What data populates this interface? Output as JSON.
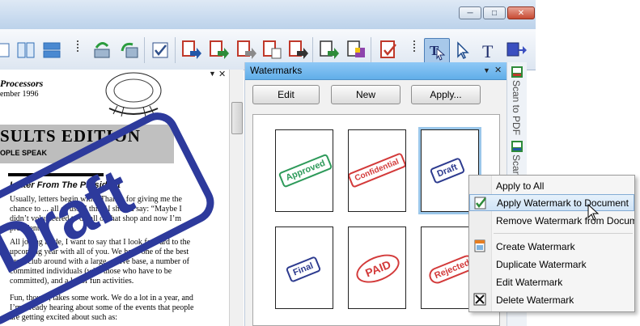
{
  "window": {
    "minimize_icon": "minimize-icon",
    "maximize_icon": "maximize-icon",
    "close_icon": "close-icon"
  },
  "toolbar": {
    "icons": [
      "page-layout-icon",
      "two-columns-icon",
      "split-view-icon",
      "scan-icon",
      "refresh-icon",
      "checklist-icon",
      "convert-pdf-icon",
      "convert-green-icon",
      "convert-gray-icon",
      "convert-doc-icon",
      "convert-dark-icon",
      "export-green-icon",
      "export-purple-icon",
      "pdf-check-icon",
      "select-tool-icon",
      "pointer-icon",
      "text-tool-icon",
      "move-tool-icon"
    ]
  },
  "document": {
    "header_title": "Processors",
    "header_date": "ember 1996",
    "banner_title": "SULTS EDITION",
    "banner_sub": "OPLE SPEAK",
    "letter_title": "Letter From The President",
    "para1": "Usually, letters begin with “Thanks for giving me the chance to ... all of us.” I think I should say: “Maybe I didn’t volunteered to do all of that shop and now I’m president!”",
    "para2": "All joking aside, I want to say that I look forward to the upcoming year with all of you. We have one of the best brew club around with a large, active base, a number of committed individuals (with those who have to be committed), and a lot of fun activities.",
    "para3": "Fun, though, takes some work. We do a lot in a year, and I’m already hearing about some of the events that people are getting excited about such as:",
    "watermark_text": "Draft"
  },
  "watermarks_pane": {
    "title": "Watermarks",
    "edit_label": "Edit",
    "new_label": "New",
    "apply_label": "Apply...",
    "thumbnails": [
      {
        "stamp": "Approved",
        "color": "#2e9a5a"
      },
      {
        "stamp": "Confidential",
        "color": "#d33a3a"
      },
      {
        "stamp": "Draft",
        "color": "#2d3b8f"
      },
      {
        "stamp": "Final",
        "color": "#2d3b8f"
      },
      {
        "stamp": "PAID",
        "color": "#d33a3a"
      },
      {
        "stamp": "Rejected",
        "color": "#d33a3a"
      }
    ]
  },
  "dock": {
    "tab1": "Scan to PDF",
    "tab2": "Scan"
  },
  "context_menu": {
    "items": [
      {
        "label": "Apply to All"
      },
      {
        "label": "Apply Watermark to Document",
        "icon": "apply-watermark-icon"
      },
      {
        "label": "Remove Watermark from Document"
      },
      {
        "label": "Create Watermark",
        "icon": "create-watermark-icon"
      },
      {
        "label": "Duplicate Watermark"
      },
      {
        "label": "Edit Watermark"
      },
      {
        "label": "Delete Watermark",
        "icon": "delete-icon"
      }
    ]
  },
  "colors": {
    "accent": "#61aee8",
    "watermark_blue": "#2d3a9c"
  }
}
